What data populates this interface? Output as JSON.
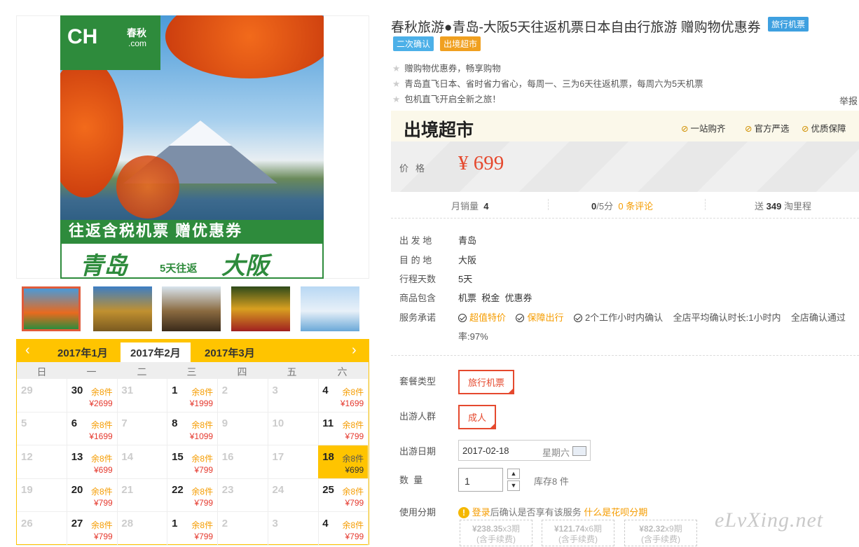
{
  "banner": {
    "logo": "CH",
    "logo_cn": "春秋",
    "logo_com": ".com",
    "slogan": "往返含税机票  赠优惠券",
    "from": "青岛",
    "mid": "5天往返",
    "to": "大阪"
  },
  "calendar": {
    "prev": "‹",
    "next": "›",
    "months": [
      "2017年1月",
      "2017年2月",
      "2017年3月"
    ],
    "weekdays": [
      "日",
      "一",
      "二",
      "三",
      "四",
      "五",
      "六"
    ],
    "rows": [
      [
        {
          "d": "29",
          "dim": true
        },
        {
          "d": "30",
          "s": "余8件",
          "p": "¥2699"
        },
        {
          "d": "31",
          "dim": true
        },
        {
          "d": "1",
          "s": "余8件",
          "p": "¥1999"
        },
        {
          "d": "2",
          "dim": true
        },
        {
          "d": "3",
          "dim": true
        },
        {
          "d": "4",
          "s": "余8件",
          "p": "¥1699"
        }
      ],
      [
        {
          "d": "5",
          "dim": true
        },
        {
          "d": "6",
          "s": "余8件",
          "p": "¥1699"
        },
        {
          "d": "7",
          "dim": true
        },
        {
          "d": "8",
          "s": "余8件",
          "p": "¥1099"
        },
        {
          "d": "9",
          "dim": true
        },
        {
          "d": "10",
          "dim": true
        },
        {
          "d": "11",
          "s": "余8件",
          "p": "¥799"
        }
      ],
      [
        {
          "d": "12",
          "dim": true
        },
        {
          "d": "13",
          "s": "余8件",
          "p": "¥699"
        },
        {
          "d": "14",
          "dim": true
        },
        {
          "d": "15",
          "s": "余8件",
          "p": "¥799"
        },
        {
          "d": "16",
          "dim": true
        },
        {
          "d": "17",
          "dim": true
        },
        {
          "d": "18",
          "s": "余8件",
          "p": "¥699",
          "hl": true
        }
      ],
      [
        {
          "d": "19",
          "dim": true
        },
        {
          "d": "20",
          "s": "余8件",
          "p": "¥799"
        },
        {
          "d": "21",
          "dim": true
        },
        {
          "d": "22",
          "s": "余8件",
          "p": "¥799"
        },
        {
          "d": "23",
          "dim": true
        },
        {
          "d": "24",
          "dim": true
        },
        {
          "d": "25",
          "s": "余8件",
          "p": "¥799"
        }
      ],
      [
        {
          "d": "26",
          "dim": true
        },
        {
          "d": "27",
          "s": "余8件",
          "p": "¥799"
        },
        {
          "d": "28",
          "dim": true
        },
        {
          "d": "1",
          "s": "余8件",
          "p": "¥799"
        },
        {
          "d": "2",
          "dim": true
        },
        {
          "d": "3",
          "dim": true
        },
        {
          "d": "4",
          "s": "余8件",
          "p": "¥799"
        }
      ]
    ]
  },
  "product": {
    "title": "春秋旅游●青岛-大阪5天往返机票日本自由行旅游 赠购物优惠券",
    "tag_main": "旅行机票",
    "tag1": "二次确认",
    "tag2": "出境超市",
    "features": [
      "赠购物优惠券，畅享购物",
      "青岛直飞日本、省时省力省心，每周一、三为6天往返机票，每周六为5天机票",
      "包机直飞开启全新之旅！"
    ],
    "report": "举报"
  },
  "market": {
    "logo": "出境超市",
    "f1": "一站购齐",
    "f2": "官方严选",
    "f3": "优质保障"
  },
  "price": {
    "label": "价格",
    "value": "¥ 699"
  },
  "stats": {
    "sales_label": "月销量",
    "sales": "4",
    "rating": "0",
    "rating_suffix": "/5分",
    "reviews": "0 条评论",
    "points_pre": "送",
    "points": "349",
    "points_suf": "淘里程"
  },
  "info": {
    "l1": "出 发 地",
    "v1": "青岛",
    "l2": "目 的 地",
    "v2": "大阪",
    "l3": "行程天数",
    "v3": "5天",
    "l4": "商品包含",
    "v4": "机票  税金  优惠券",
    "l5": "服务承诺",
    "svc1": "超值特价",
    "svc2": "保障出行",
    "svc3": "2个工作小时内确认",
    "svc4": "全店平均确认时长:1小时内",
    "svc5": "全店确认通过",
    "svc6": "率:97%"
  },
  "options": {
    "pkg_label": "套餐类型",
    "pkg": "旅行机票",
    "crowd_label": "出游人群",
    "crowd": "成人",
    "date_label": "出游日期",
    "date": "2017-02-18",
    "weekday": "星期六",
    "qty_label": "数  量",
    "qty": "1",
    "stock": "库存8 件",
    "inst_label": "使用分期",
    "login": "登录",
    "inst_text": "后确认是否享有该服务",
    "huabei": "什么是花呗分期",
    "plans": [
      {
        "amt": "¥238.35",
        "per": "x3期",
        "fee": "(含手续费)"
      },
      {
        "amt": "¥121.74",
        "per": "x6期",
        "fee": "(含手续费)"
      },
      {
        "amt": "¥82.32",
        "per": "x9期",
        "fee": "(含手续费)"
      }
    ]
  },
  "watermark": "eLvXing.net"
}
